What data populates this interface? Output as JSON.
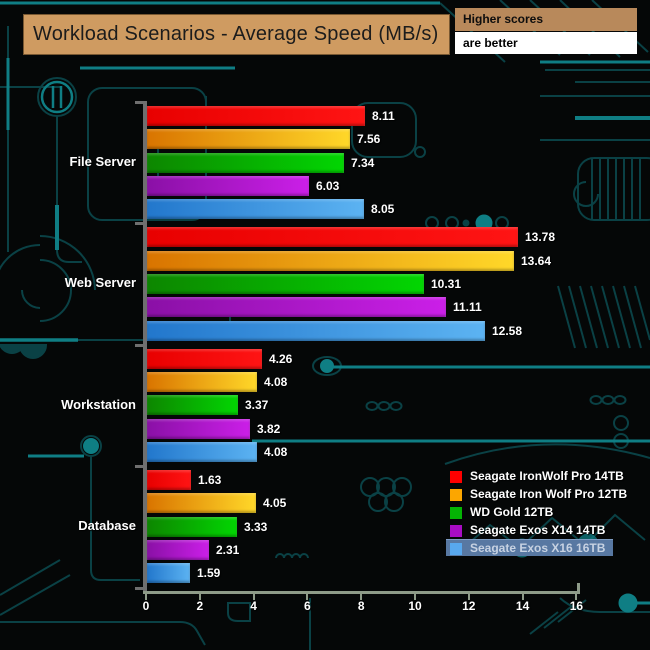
{
  "title": "Workload Scenarios - Average Speed (MB/s)",
  "note": {
    "line1": "Higher scores",
    "line2": "are better"
  },
  "chart_data": {
    "type": "bar",
    "orientation": "horizontal",
    "title": "Workload Scenarios - Average Speed (MB/s)",
    "categories": [
      "File Server",
      "Web Server",
      "Workstation",
      "Database"
    ],
    "series": [
      {
        "name": "Seagate IronWolf Pro 14TB",
        "color": "#ff0000",
        "gradient": [
          "#e80000",
          "#ff1414"
        ],
        "values": [
          8.11,
          13.78,
          4.26,
          1.63
        ]
      },
      {
        "name": "Seagate Iron Wolf Pro 12TB",
        "color": "#fca600",
        "gradient": [
          "#d97400",
          "#ffd829"
        ],
        "values": [
          7.56,
          13.64,
          4.08,
          4.05
        ]
      },
      {
        "name": "WD Gold 12TB",
        "color": "#04b404",
        "gradient": [
          "#0d8600",
          "#02d602"
        ],
        "values": [
          7.34,
          10.31,
          3.37,
          3.33
        ]
      },
      {
        "name": "Seagate Exos X14 14TB",
        "color": "#a80cc4",
        "gradient": [
          "#8a10a6",
          "#cb1fe8"
        ],
        "values": [
          6.03,
          11.11,
          3.82,
          2.31
        ]
      },
      {
        "name": "Seagate Exos X16 16TB",
        "color": "#58a8ee",
        "gradient": [
          "#2277cc",
          "#5cb3f2"
        ],
        "values": [
          8.05,
          12.58,
          4.08,
          1.59
        ],
        "highlighted": true
      }
    ],
    "xlim": [
      0,
      16
    ],
    "x_ticks": [
      0,
      2,
      4,
      6,
      8,
      10,
      12,
      14,
      16
    ],
    "value_labels": true,
    "legend_position": "bottom-right",
    "legend_highlight_color": "#5878a2",
    "grid": false
  }
}
